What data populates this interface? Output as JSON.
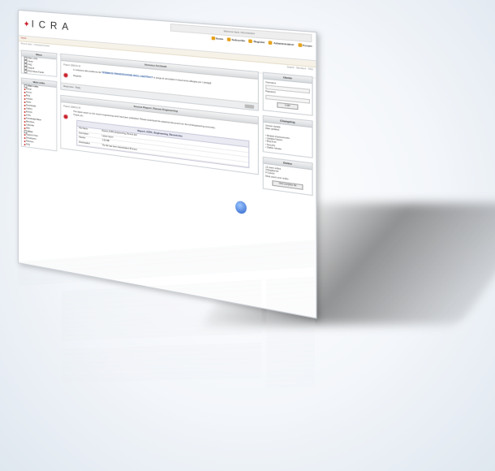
{
  "logo": {
    "text": "ICRA"
  },
  "header": {
    "userbar": "Welcome back, Administrator",
    "nav": [
      {
        "label": "Home",
        "icon": "home-icon"
      },
      {
        "label": "Subscribe",
        "icon": "rss-icon"
      },
      {
        "label": "Register",
        "icon": "user-icon"
      },
      {
        "label": "Administration",
        "icon": "gear-icon"
      },
      {
        "label": "Forum",
        "icon": "chat-icon"
      }
    ]
  },
  "breadcrumb": "Home",
  "subbar": {
    "left": "Recent topics · Unanswered posts",
    "right": "Search · Members · FAQ"
  },
  "left": {
    "menu_title": "Menu",
    "menu_items": [
      "Main Links",
      "News",
      "FAQ",
      "Search",
      "RSS News Feeds"
    ],
    "links_title": "Web Links",
    "links_head": "Main Links",
    "links": [
      "Portal",
      "Forum",
      "Blog",
      "Articles",
      "News",
      "Downloads",
      "Gallery",
      "Events",
      "Links",
      "Knowledge Base",
      "Members",
      "Calendar",
      "Wiki"
    ],
    "more_title": "More",
    "more": [
      "Support Area",
      "Developers",
      "Partners",
      "FAQ"
    ]
  },
  "center": {
    "post1": {
      "title": "Annunci Archivati",
      "meta": "Posted: 2008-01-10",
      "text1": "In relazione alla scadenza dei",
      "highlight": "TERMINI DI PRESENTAZIONE DEGLI ABSTRACT",
      "text2": "si prega di consultare il documento allegato per i dettagli.",
      "text3": "Regards,",
      "footer": "Read more · Reply"
    },
    "post2": {
      "title": "Source Report: Recent Engineering",
      "meta": "Posted: 2008-01-04",
      "text1": "The latest report on the recent engineering work has been published. Please download the attached document for the full Engineering summary.",
      "text2": "Thank you."
    },
    "attachment": {
      "title": "Report_ICRA_Engineering_Recent.doc",
      "rows": [
        {
          "k": "File Name",
          "v": "Report_ICRA_Engineering_Recent.doc"
        },
        {
          "k": "Description",
          "v": "Latest report"
        },
        {
          "k": "Filesize",
          "v": "1.56 MB"
        },
        {
          "k": "Downloaded",
          "v": "The file has been downloaded 45 times"
        }
      ]
    }
  },
  "right": {
    "login_title": "Utente",
    "login_user": "Username",
    "login_pass": "Password",
    "login_btn": "Login",
    "changelog_title": "Changelog",
    "changelog": [
      "Version details",
      "Date updated",
      "Module improvements",
      "Updated layout",
      "Bug fixes",
      "Security",
      "Stable release"
    ],
    "online_title": "Online",
    "online": [
      "12 users online",
      "3 Registered",
      "9 Guests",
      "Most users ever online"
    ],
    "online_btn": "View complete list"
  }
}
